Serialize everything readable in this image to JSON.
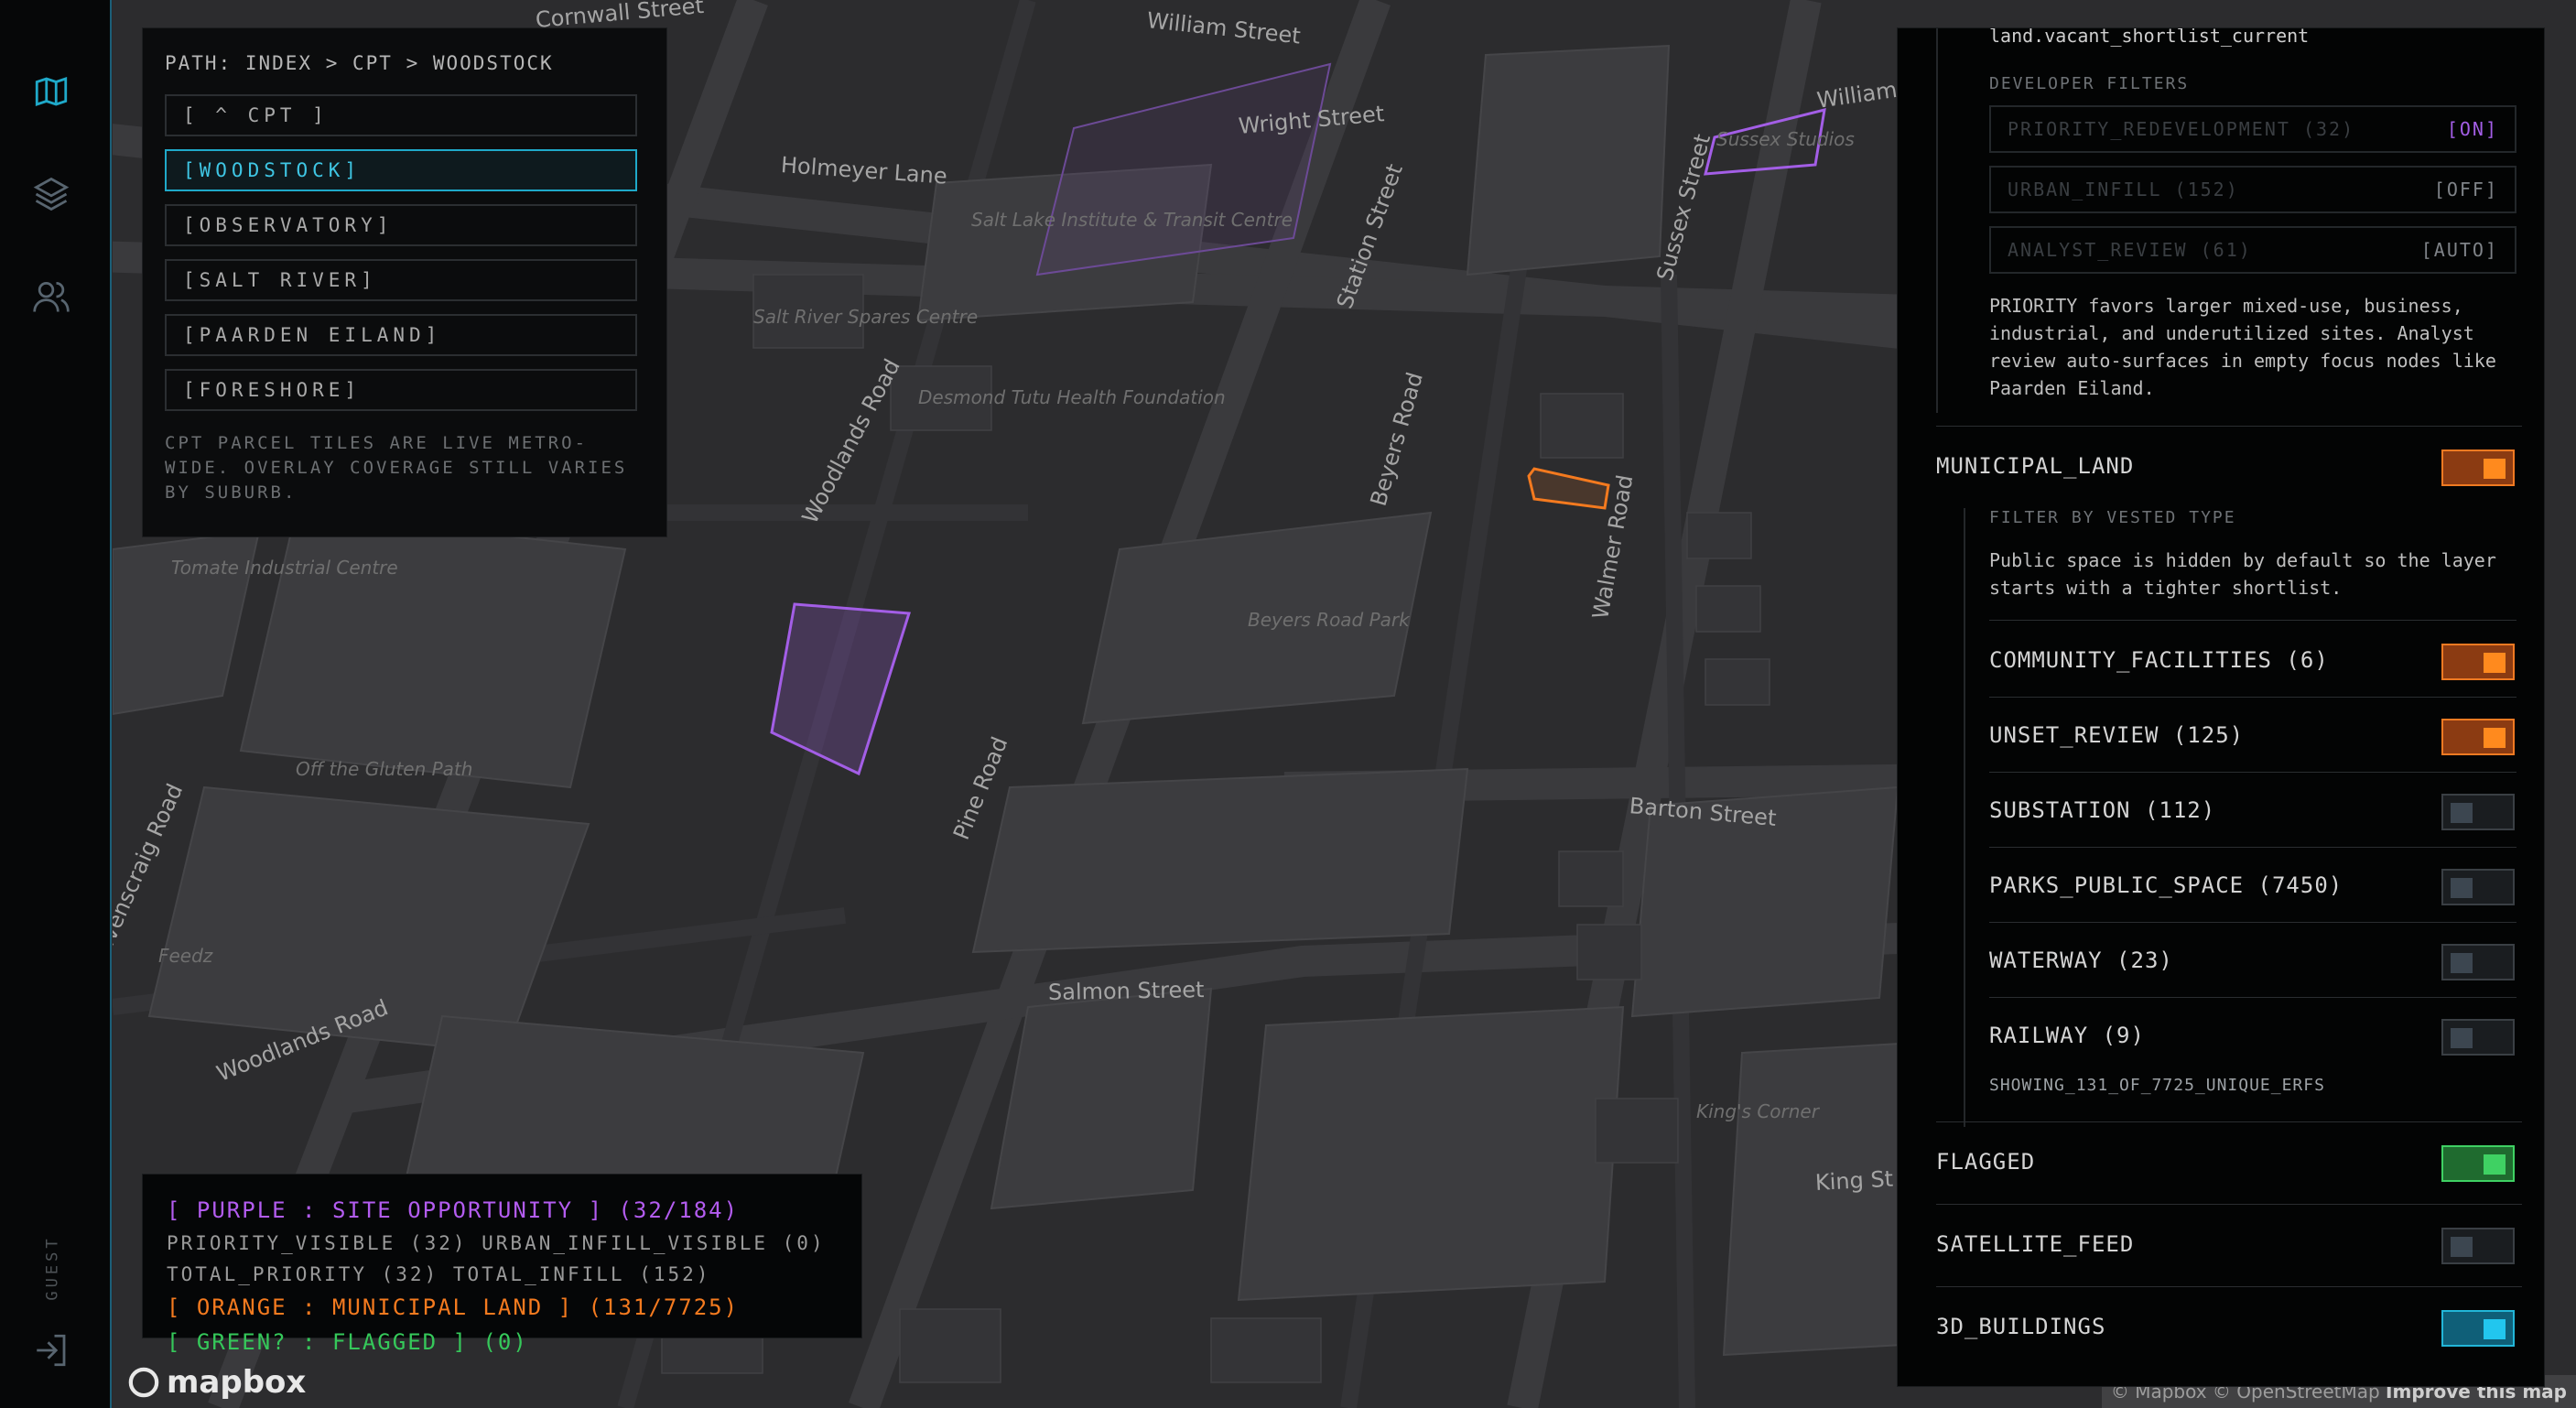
{
  "rail": {
    "icons": [
      "map-icon",
      "layers-icon",
      "users-icon",
      "logout-icon"
    ],
    "guest_label": "GUEST",
    "accent": "#1fa9c9"
  },
  "nav": {
    "path": "PATH: INDEX > CPT > WOODSTOCK",
    "buttons": [
      {
        "label": "[ ^ CPT ]",
        "active": false
      },
      {
        "label": "[WOODSTOCK]",
        "active": true
      },
      {
        "label": "[OBSERVATORY]",
        "active": false
      },
      {
        "label": "[SALT RIVER]",
        "active": false
      },
      {
        "label": "[PAARDEN EILAND]",
        "active": false
      },
      {
        "label": "[FORESHORE]",
        "active": false
      }
    ],
    "note": "CPT PARCEL TILES ARE LIVE METRO-WIDE. OVERLAY COVERAGE STILL VARIES BY SUBURB."
  },
  "map": {
    "street_labels": [
      "Cornwall Street",
      "William Street",
      "Wright Street",
      "Holmeyer Lane",
      "Station Street",
      "Sussex Street",
      "Woodlands Road",
      "Beyers Road",
      "Walmer Road",
      "Beyers Road Park",
      "Barton Street",
      "Pine Road",
      "Salmon Street",
      "Ravenscraig Road",
      "Woodlands Road",
      "King St",
      "William"
    ],
    "poi_labels": [
      "Salt Lake Institute & Transit Centre",
      "Salt River Spares Centre",
      "Desmond Tutu Health Foundation",
      "Tomate Industrial Centre",
      "Off the Gluten Path",
      "Feedz",
      "King's Corner",
      "Sussex Studios"
    ],
    "attribution": {
      "mapbox": "© Mapbox",
      "osm": "© OpenStreetMap",
      "improve": "Improve this map"
    },
    "logo": "mapbox",
    "colors": {
      "purple": "#a35ee6",
      "orange": "#f47a1f"
    }
  },
  "legend": {
    "site_opportunity": "[ PURPLE : SITE OPPORTUNITY ] (32/184)",
    "priority_line": "PRIORITY_VISIBLE (32) URBAN_INFILL_VISIBLE (0)",
    "total_line": "TOTAL_PRIORITY (32) TOTAL_INFILL (152)",
    "municipal_land": "[ ORANGE : MUNICIPAL LAND ] (131/7725)",
    "flagged": "[ GREEN? : FLAGGED ] (0)"
  },
  "panel": {
    "top_text": "land.vacant_shortlist_current",
    "developer_filters_title": "DEVELOPER FILTERS",
    "filters": [
      {
        "label": "PRIORITY_REDEVELOPMENT (32)",
        "value": "[ON]",
        "on": true
      },
      {
        "label": "URBAN_INFILL (152)",
        "value": "[OFF]",
        "on": false
      },
      {
        "label": "ANALYST_REVIEW (61)",
        "value": "[AUTO]",
        "on": false
      }
    ],
    "priority_desc": "PRIORITY favors larger mixed-use, business, industrial, and underutilized sites. Analyst review auto-surfaces in empty focus nodes like Paarden Eiland.",
    "municipal_land_label": "MUNICIPAL_LAND",
    "filter_by_vested": "FILTER BY VESTED TYPE",
    "public_space_desc": "Public space is hidden by default so the layer starts with a tighter shortlist.",
    "vested_types": [
      {
        "label": "COMMUNITY_FACILITIES (6)",
        "state": "on-orange"
      },
      {
        "label": "UNSET_REVIEW (125)",
        "state": "on-orange"
      },
      {
        "label": "SUBSTATION (112)",
        "state": "off"
      },
      {
        "label": "PARKS_PUBLIC_SPACE (7450)",
        "state": "off"
      },
      {
        "label": "WATERWAY (23)",
        "state": "off"
      },
      {
        "label": "RAILWAY (9)",
        "state": "off"
      }
    ],
    "showing": "SHOWING_131_OF_7725_UNIQUE_ERFS",
    "layers": [
      {
        "label": "FLAGGED",
        "state": "on-green"
      },
      {
        "label": "SATELLITE_FEED",
        "state": "off"
      },
      {
        "label": "3D_BUILDINGS",
        "state": "on-cyan"
      }
    ]
  }
}
